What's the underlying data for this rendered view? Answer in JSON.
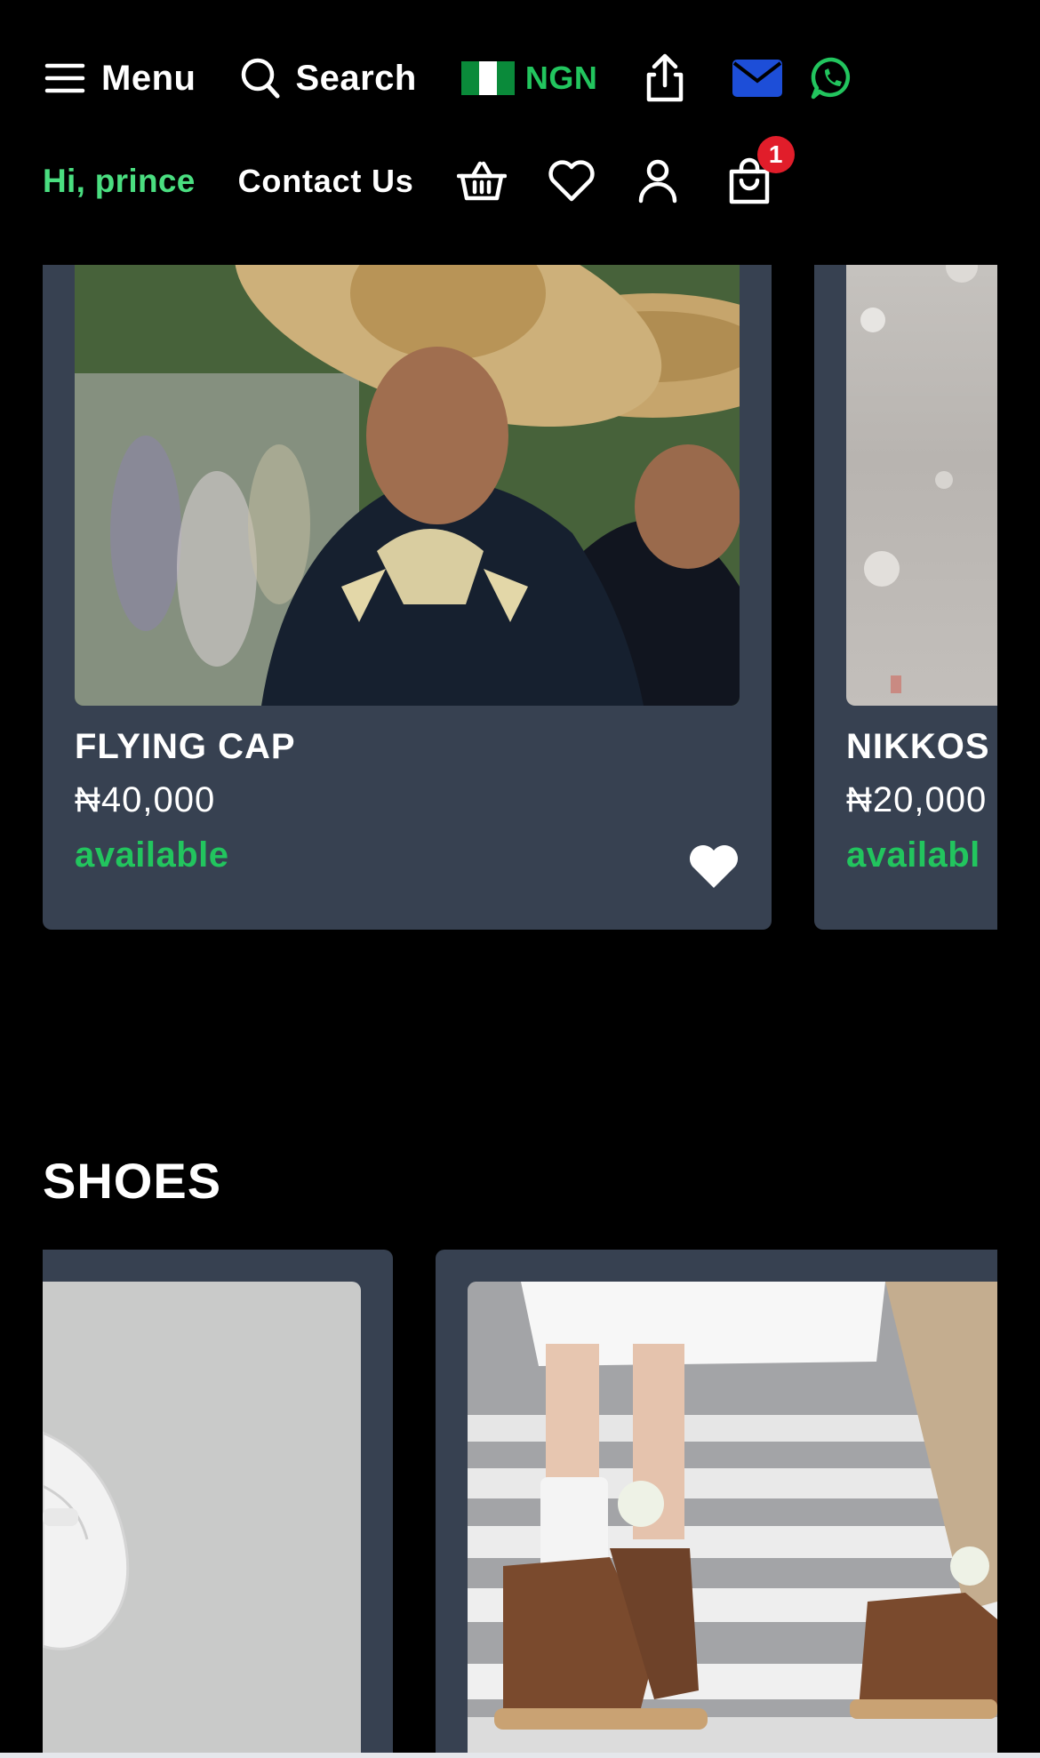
{
  "header": {
    "menu_label": "Menu",
    "search_label": "Search",
    "currency_label": "NGN",
    "greeting": "Hi, prince",
    "contact_label": "Contact Us",
    "cart_count": "1"
  },
  "colors": {
    "background": "#000000",
    "card": "#374151",
    "accent_green": "#22c55e",
    "mail_blue": "#1d4ed8",
    "badge_red": "#e11d2a"
  },
  "icons": [
    "menu-icon",
    "search-icon",
    "nigeria-flag-icon",
    "share-icon",
    "mail-icon",
    "whatsapp-icon",
    "basket-icon",
    "heart-icon",
    "user-icon",
    "cart-icon"
  ],
  "products_top": [
    {
      "name": "FLYING CAP",
      "price": "₦40,000",
      "status": "available"
    },
    {
      "name": "NIKKOS",
      "price": "₦20,000",
      "status": "availabl"
    }
  ],
  "shoes_section": {
    "title": "SHOES"
  }
}
